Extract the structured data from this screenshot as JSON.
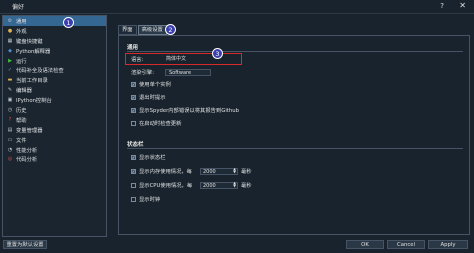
{
  "window": {
    "title": "偏好",
    "help_glyph": "?",
    "close_glyph": "✕"
  },
  "sidebar": {
    "items": [
      {
        "label": "通用",
        "icon": "gear-icon",
        "glyph": "⚙",
        "color": "#b0b8c0"
      },
      {
        "label": "外观",
        "icon": "palette-icon",
        "glyph": "●",
        "color": "#e0b050"
      },
      {
        "label": "键盘快捷键",
        "icon": "keyboard-icon",
        "glyph": "▦",
        "color": "#c0c8d0"
      },
      {
        "label": "Python解释器",
        "icon": "python-icon",
        "glyph": "◆",
        "color": "#4a8fd0"
      },
      {
        "label": "运行",
        "icon": "run-icon",
        "glyph": "▶",
        "color": "#3ec43e"
      },
      {
        "label": "代码补全及语法检查",
        "icon": "code-check-icon",
        "glyph": "✓",
        "color": "#58a0e0"
      },
      {
        "label": "当前工作目录",
        "icon": "folder-icon",
        "glyph": "▬",
        "color": "#e0b050"
      },
      {
        "label": "编辑器",
        "icon": "editor-icon",
        "glyph": "✎",
        "color": "#c0c8d0"
      },
      {
        "label": "IPython控制台",
        "icon": "ipython-icon",
        "glyph": "▣",
        "color": "#c0c8d0"
      },
      {
        "label": "历史",
        "icon": "history-icon",
        "glyph": "◷",
        "color": "#c0c8d0"
      },
      {
        "label": "帮助",
        "icon": "help-icon",
        "glyph": "?",
        "color": "#e05050"
      },
      {
        "label": "变量管理器",
        "icon": "variable-icon",
        "glyph": "▤",
        "color": "#c0c8d0"
      },
      {
        "label": "文件",
        "icon": "file-icon",
        "glyph": "▭",
        "color": "#c0c8d0"
      },
      {
        "label": "性能分析",
        "icon": "profiler-icon",
        "glyph": "◔",
        "color": "#c0c8d0"
      },
      {
        "label": "代码分析",
        "icon": "code-analysis-icon",
        "glyph": "◎",
        "color": "#e05050"
      }
    ],
    "selected_index": 0
  },
  "annotations": {
    "a1": "1",
    "a2": "2",
    "a3": "3"
  },
  "tabs": {
    "interface": "界面",
    "advanced": "高级设置"
  },
  "general": {
    "group_title": "通用",
    "language_label": "语言:",
    "language_value": "简体中文",
    "rendering_label": "渲染引擎:",
    "rendering_value": "Software",
    "single_instance": "使用单个实例",
    "prompt_exit": "退出时提示",
    "report_github": "显示Spyder内部错误以将其报告到Github",
    "check_updates": "在启动时检查更新"
  },
  "statusbar": {
    "group_title": "状态栏",
    "show_status": "显示状态栏",
    "memory_label": "显示内存使用情况，每",
    "memory_value": "2000",
    "memory_unit": "毫秒",
    "cpu_label": "显示CPU使用情况，每",
    "cpu_value": "2000",
    "cpu_unit": "毫秒",
    "show_clock": "显示时钟"
  },
  "checkbox_state": {
    "single_instance": true,
    "prompt_exit": true,
    "report_github": true,
    "check_updates": false,
    "show_status": true,
    "memory": true,
    "cpu": false,
    "clock": false
  },
  "buttons": {
    "reset": "重置为默认设置",
    "ok": "OK",
    "cancel": "Cancel",
    "apply": "Apply"
  }
}
